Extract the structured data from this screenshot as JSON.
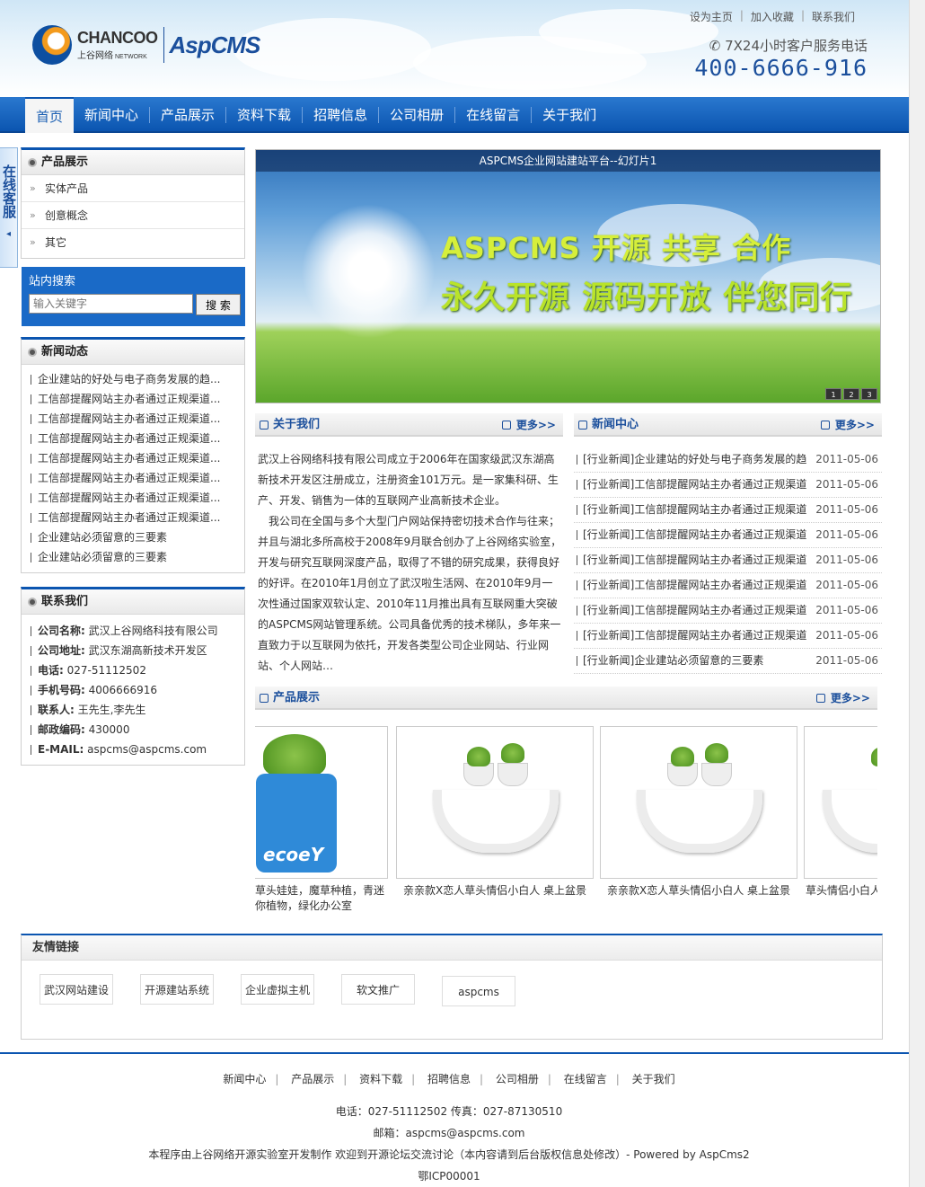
{
  "top_links": [
    "设为主页",
    "加入收藏",
    "联系我们"
  ],
  "logo": {
    "brand_en": "CHANCOO",
    "brand_cn": "上谷网络",
    "network": "NETWORK",
    "product": "AspCMS"
  },
  "hotline": {
    "label": "7X24小时客户服务电话",
    "number": "400-6666-916"
  },
  "nav": [
    "首页",
    "新闻中心",
    "产品展示",
    "资料下载",
    "招聘信息",
    "公司相册",
    "在线留言",
    "关于我们"
  ],
  "kefu": "在线客服",
  "sidebar": {
    "products": {
      "title": "产品展示",
      "items": [
        "实体产品",
        "创意概念",
        "其它"
      ]
    },
    "search": {
      "title": "站内搜索",
      "placeholder": "输入关键字",
      "button": "搜 索"
    },
    "news": {
      "title": "新闻动态",
      "items": [
        "企业建站的好处与电子商务发展的趋...",
        "工信部提醒网站主办者通过正规渠道...",
        "工信部提醒网站主办者通过正规渠道...",
        "工信部提醒网站主办者通过正规渠道...",
        "工信部提醒网站主办者通过正规渠道...",
        "工信部提醒网站主办者通过正规渠道...",
        "工信部提醒网站主办者通过正规渠道...",
        "工信部提醒网站主办者通过正规渠道...",
        "企业建站必须留意的三要素",
        "企业建站必须留意的三要素"
      ]
    },
    "contact": {
      "title": "联系我们",
      "items": [
        {
          "k": "公司名称:",
          "v": "武汉上谷网络科技有限公司"
        },
        {
          "k": "公司地址:",
          "v": "武汉东湖高新技术开发区"
        },
        {
          "k": "电话:",
          "v": "027-51112502"
        },
        {
          "k": "手机号码:",
          "v": "4006666916"
        },
        {
          "k": "联系人:",
          "v": "王先生,李先生"
        },
        {
          "k": "邮政编码:",
          "v": "430000"
        },
        {
          "k": "E-MAIL:",
          "v": "aspcms@aspcms.com"
        }
      ]
    }
  },
  "banner": {
    "caption": "ASPCMS企业网站建站平台--幻灯片1",
    "line1": "ASPCMS 开源  共享  合作",
    "line2": "永久开源 源码开放 伴您同行",
    "pages": [
      "1",
      "2",
      "3"
    ]
  },
  "about": {
    "title": "关于我们",
    "more": "更多>>",
    "paragraphs": [
      "武汉上谷网络科技有限公司成立于2006年在国家级武汉东湖高新技术开发区注册成立，注册资金101万元。是一家集科研、生产、开发、销售为一体的互联网产业高新技术企业。",
      "我公司在全国与多个大型门户网站保持密切技术合作与往来；并且与湖北多所高校于2008年9月联合创办了上谷网络实验室，开发与研究互联网深度产品，取得了不错的研究成果，获得良好的好评。在2010年1月创立了武汉啦生活网、在2010年9月一次性通过国家双软认定、2010年11月推出具有互联网重大突破的ASPCMS网站管理系统。公司具备优秀的技术梯队，多年来一直致力于以互联网为依托，开发各类型公司企业网站、行业网站、个人网站…"
    ]
  },
  "news_center": {
    "title": "新闻中心",
    "more": "更多>>",
    "items": [
      {
        "t": "[行业新闻]企业建站的好处与电子商务发展的趋",
        "d": "2011-05-06"
      },
      {
        "t": "[行业新闻]工信部提醒网站主办者通过正规渠道",
        "d": "2011-05-06"
      },
      {
        "t": "[行业新闻]工信部提醒网站主办者通过正规渠道",
        "d": "2011-05-06"
      },
      {
        "t": "[行业新闻]工信部提醒网站主办者通过正规渠道",
        "d": "2011-05-06"
      },
      {
        "t": "[行业新闻]工信部提醒网站主办者通过正规渠道",
        "d": "2011-05-06"
      },
      {
        "t": "[行业新闻]工信部提醒网站主办者通过正规渠道",
        "d": "2011-05-06"
      },
      {
        "t": "[行业新闻]工信部提醒网站主办者通过正规渠道",
        "d": "2011-05-06"
      },
      {
        "t": "[行业新闻]工信部提醒网站主办者通过正规渠道",
        "d": "2011-05-06"
      },
      {
        "t": "[行业新闻]企业建站必须留意的三要素",
        "d": "2011-05-06"
      }
    ]
  },
  "products": {
    "title": "产品展示",
    "more": "更多>>",
    "items": [
      "草头娃娃，魔草种植，青迷你植物，绿化办公室",
      "亲亲款X恋人草头情侣小白人  桌上盆景",
      "亲亲款X恋人草头情侣小白人  桌上盆景",
      "草头情侣小白人"
    ]
  },
  "friend_links": {
    "title": "友情链接",
    "items": [
      "武汉网站建设",
      "开源建站系统",
      "企业虚拟主机",
      "软文推广",
      "aspcms"
    ]
  },
  "footer": {
    "nav": [
      "新闻中心",
      "产品展示",
      "资料下载",
      "招聘信息",
      "公司相册",
      "在线留言",
      "关于我们"
    ],
    "phone": "电话：027-51112502 传真：027-87130510",
    "email": "邮箱：aspcms@aspcms.com",
    "credit": "本程序由上谷网络开源实验室开发制作 欢迎到开源论坛交流讨论（本内容请到后台版权信息处修改）- Powered by AspCms2",
    "icp": "鄂ICP00001"
  }
}
